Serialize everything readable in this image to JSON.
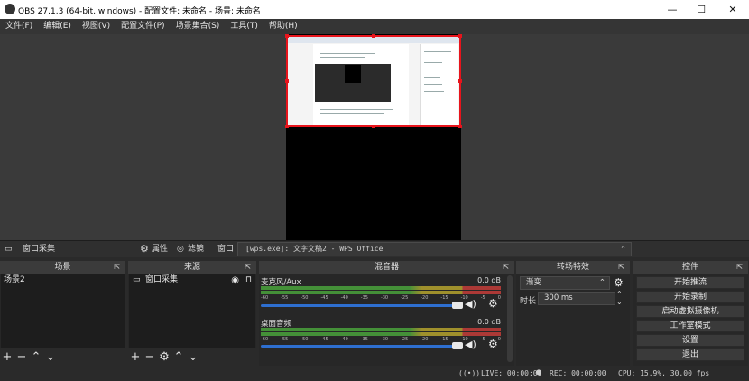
{
  "window": {
    "title": "OBS 27.1.3 (64-bit, windows) - 配置文件: 未命名 - 场景: 未命名",
    "minimize": "—",
    "maximize": "☐",
    "close": "✕"
  },
  "menu": [
    "文件(F)",
    "编辑(E)",
    "视图(V)",
    "配置文件(P)",
    "场景集合(S)",
    "工具(T)",
    "帮助(H)"
  ],
  "sourcebar": {
    "source_name": "窗口采集",
    "properties": "属性",
    "filters": "滤镜",
    "window_label": "窗口",
    "window_value": "[wps.exe]: 文字文稿2 - WPS Office"
  },
  "scenes": {
    "title": "场景",
    "items": [
      "场景2"
    ]
  },
  "sources": {
    "title": "来源",
    "items": [
      "窗口采集"
    ]
  },
  "mixer": {
    "title": "混音器",
    "tracks": [
      {
        "name": "麦克风/Aux",
        "db": "0.0 dB",
        "level": 0.62
      },
      {
        "name": "桌面音频",
        "db": "0.0 dB",
        "level": 0.62
      }
    ],
    "ticks": [
      "-60",
      "-55",
      "-50",
      "-45",
      "-40",
      "-35",
      "-30",
      "-25",
      "-20",
      "-15",
      "-10",
      "-5",
      "0"
    ]
  },
  "transitions": {
    "title": "转场特效",
    "type": "渐变",
    "duration_label": "时长",
    "duration": "300 ms"
  },
  "controls": {
    "title": "控件",
    "buttons": [
      "开始推流",
      "开始录制",
      "启动虚拟摄像机",
      "工作室模式",
      "设置",
      "退出"
    ]
  },
  "status": {
    "live": "LIVE: 00:00:00",
    "rec": "REC: 00:00:00",
    "cpu": "CPU: 15.9%, 30.00 fps"
  },
  "colors": {
    "selection": "#e8141c",
    "volume": "#2e6fd0",
    "meter_green": "#49a33b",
    "meter_yellow": "#b4a22d",
    "meter_red": "#c43c38"
  }
}
